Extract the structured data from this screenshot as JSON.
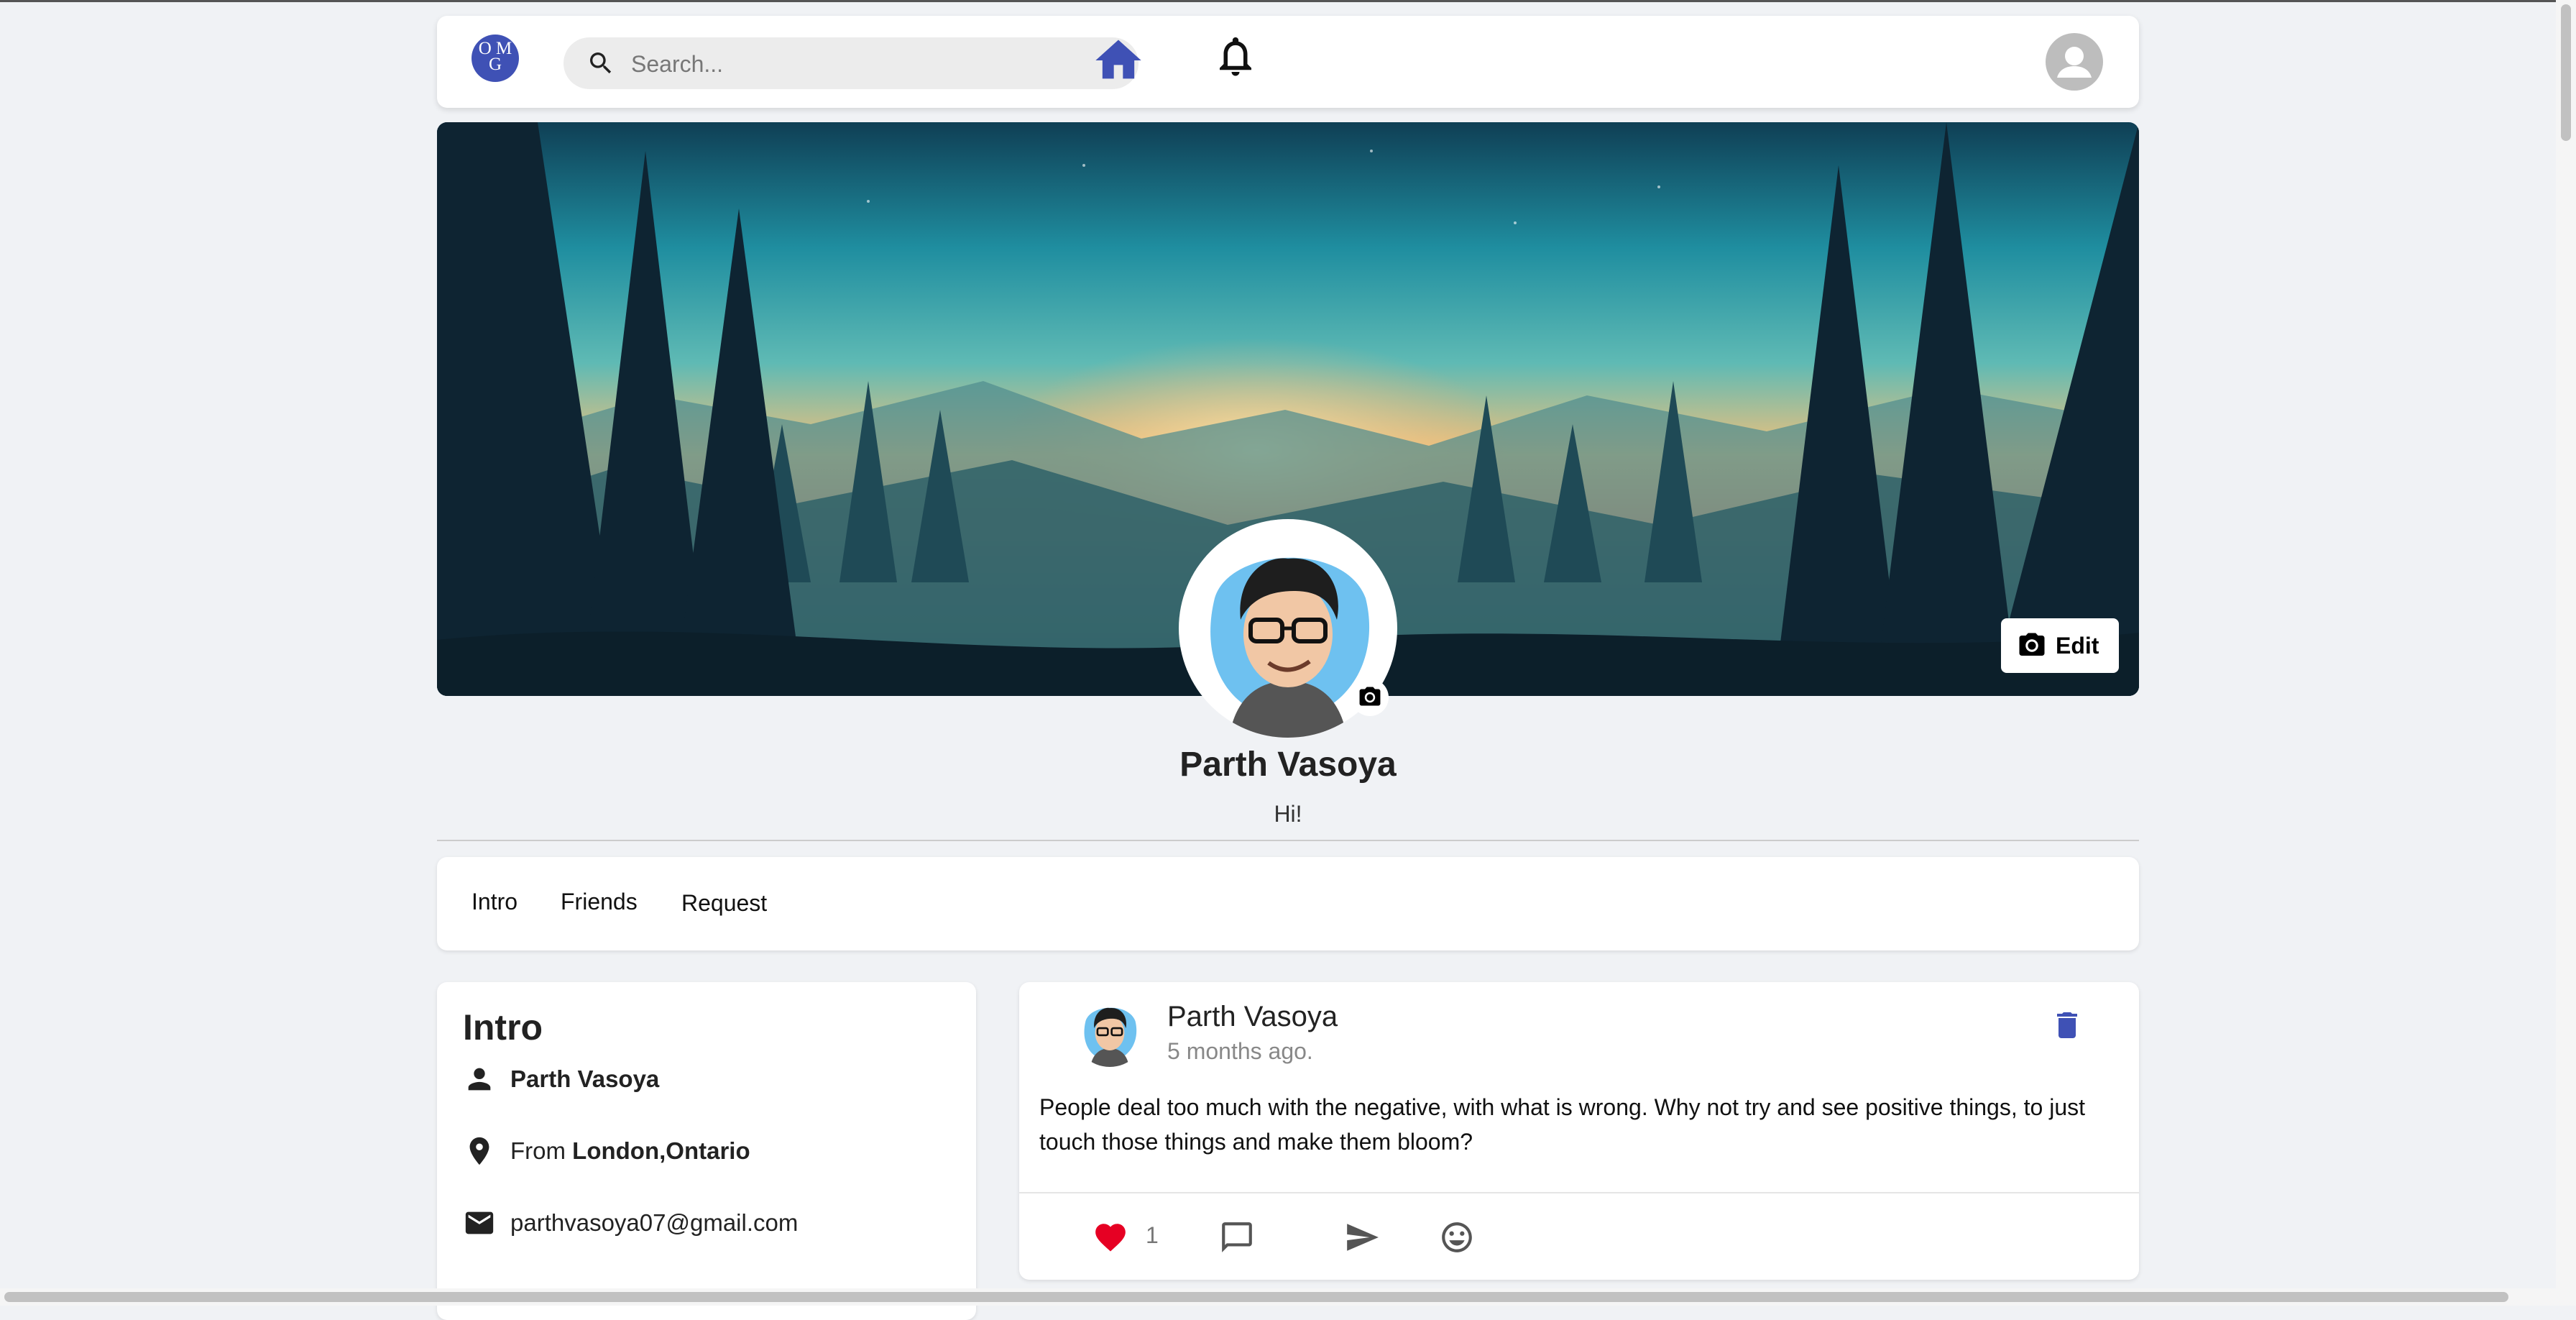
{
  "header": {
    "logo_text": "OMG",
    "search": {
      "placeholder": "Search..."
    },
    "icons": [
      "home-icon",
      "bell-icon",
      "account-icon"
    ],
    "accent": "#3f51b5"
  },
  "cover": {
    "edit_label": "Edit"
  },
  "profile": {
    "name": "Parth Vasoya",
    "bio": "Hi!"
  },
  "tabs": [
    {
      "label": "Intro"
    },
    {
      "label": "Friends"
    },
    {
      "label": "Request"
    }
  ],
  "intro": {
    "title": "Intro",
    "name": "Parth Vasoya",
    "from_prefix": "From",
    "location": "London,Ontario",
    "email": "parthvasoya07@gmail.com"
  },
  "post": {
    "author": "Parth Vasoya",
    "time": "5 months ago.",
    "text": "People deal too much with the negative, with what is wrong. Why not try and see positive things, to just touch those things and make them bloom?",
    "likes": "1",
    "like_color": "#e60023"
  }
}
